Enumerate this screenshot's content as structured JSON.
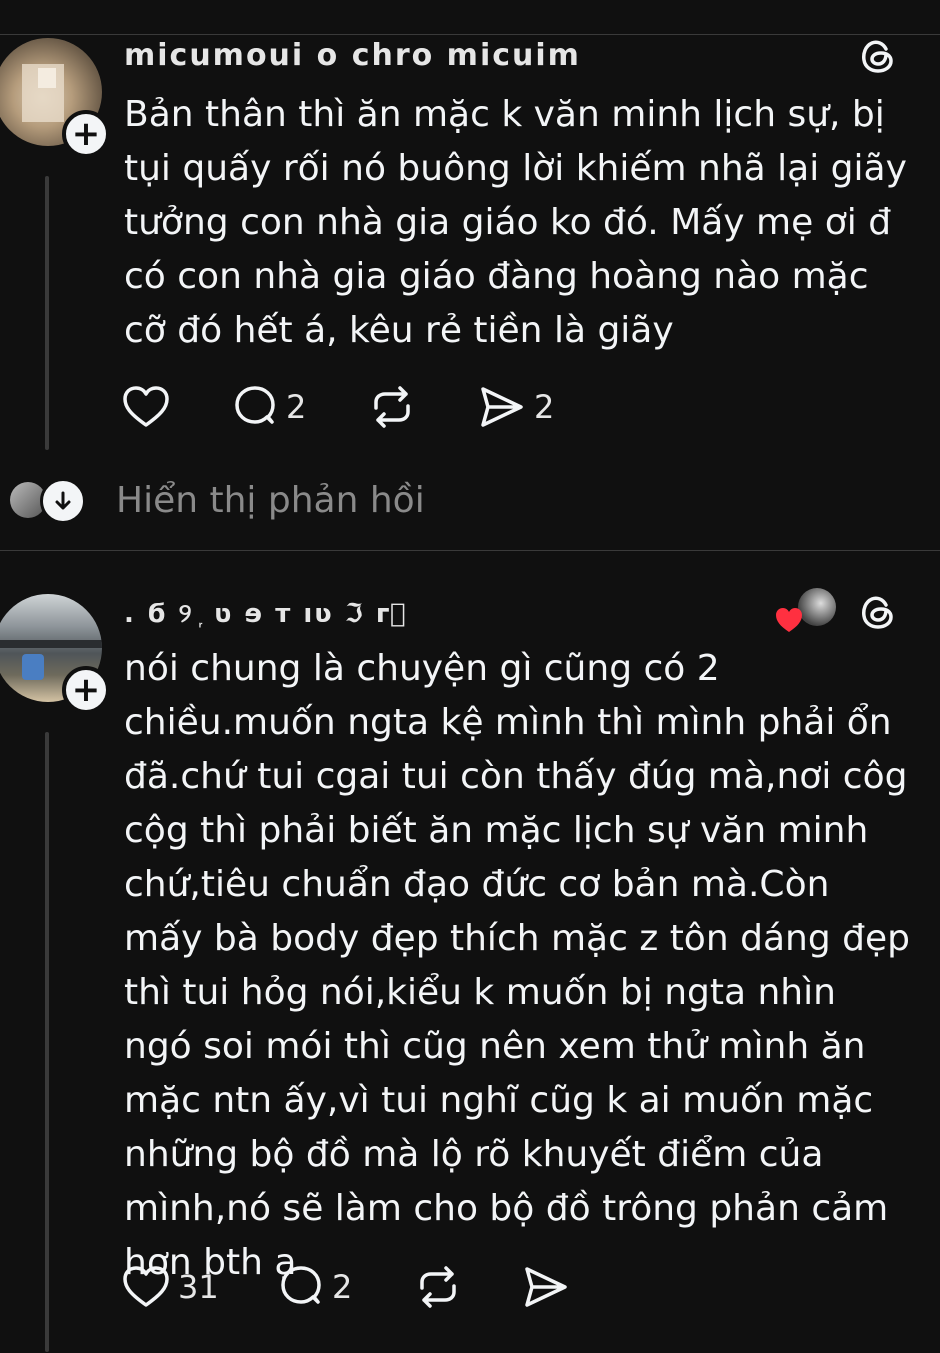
{
  "posts": [
    {
      "username": "micumoui o chro micuim",
      "body": "Bản thân thì ăn mặc k văn minh lịch sự, bị tụi quấy rối nó buông lời khiếm nhã lại giãy tưởng con nhà gia giáo ko đó. Mấy mẹ ơi đ có con nhà gia giáo đàng hoàng nào mặc cỡ đó hết á, kêu rẻ tiền là giãy",
      "likes": "",
      "replies": "2",
      "reposts": "",
      "shares": "2"
    },
    {
      "username": ". ϭ ୨ ᷊ ט ɘ ᴛ ıʋ ℑ ᴦ⃝",
      "body": "nói chung là chuyện gì cũng có 2 chiều.muốn ngta kệ mình thì mình phải ổn đã.chứ tui cgai tui còn thấy đúg mà,nơi côg cộg thì phải biết ăn mặc lịch sự văn minh chứ,tiêu chuẩn đạo đức cơ bản mà.Còn mấy bà body đẹp thích mặc z tôn dáng đẹp thì tui hỏg nói,kiểu k muốn bị ngta nhìn ngó soi mói thì cũg nên xem thử mình ăn mặc ntn ấy,vì tui nghĩ cũg k ai muốn mặc những bộ đồ mà lộ rõ khuyết điểm của mình,nó sẽ làm cho bộ đồ trông phản cảm hơn bth ạ",
      "likes": "31",
      "replies": "2",
      "reposts": "",
      "shares": ""
    }
  ],
  "show_replies_label": "Hiển thị phản hồi",
  "colors": {
    "background": "#101010",
    "text": "#f3f5f7",
    "muted": "#8a8a8a",
    "heart": "#ff3040"
  },
  "icons": [
    "plus-icon",
    "threads-logo-icon",
    "heart-icon",
    "comment-icon",
    "repost-icon",
    "share-icon",
    "arrow-down-icon"
  ]
}
